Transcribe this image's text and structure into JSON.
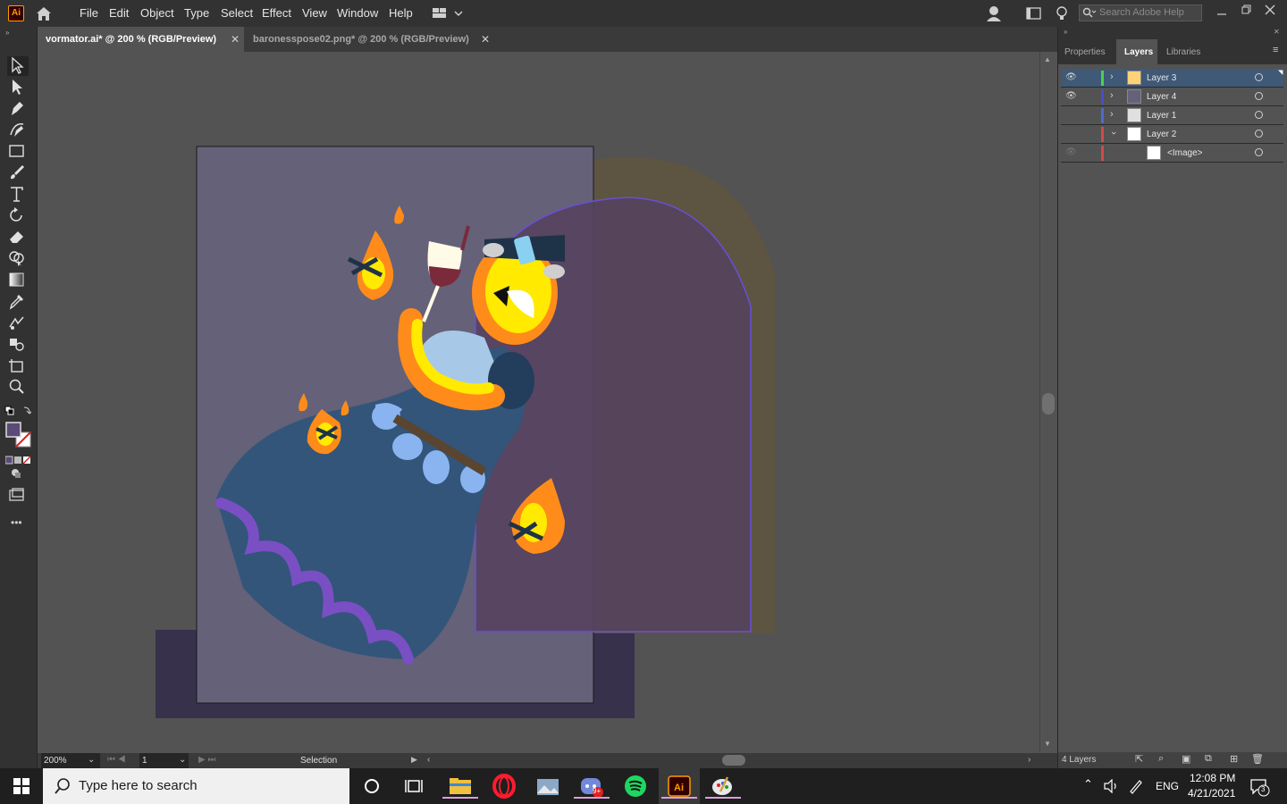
{
  "app": {
    "logo": "Ai",
    "name": "Adobe Illustrator"
  },
  "menu": {
    "items": [
      "File",
      "Edit",
      "Object",
      "Type",
      "Select",
      "Effect",
      "View",
      "Window",
      "Help"
    ],
    "search_placeholder": "Search Adobe Help"
  },
  "tabs": [
    {
      "label": "vormator.ai* @ 200 % (RGB/Preview)",
      "active": true
    },
    {
      "label": "baronesspose02.png* @ 200 % (RGB/Preview)",
      "active": false
    }
  ],
  "tools": [
    "selection-tool-icon",
    "direct-selection-tool-icon",
    "pen-tool-icon",
    "curvature-tool-icon",
    "rectangle-tool-icon",
    "paintbrush-tool-icon",
    "type-tool-icon",
    "rotate-tool-icon",
    "eraser-tool-icon",
    "shape-builder-tool-icon",
    "gradient-tool-icon",
    "eyedropper-tool-icon",
    "blend-tool-icon",
    "symbol-sprayer-tool-icon",
    "artboard-tool-icon",
    "zoom-tool-icon"
  ],
  "status": {
    "zoom": "200%",
    "artboard": "1",
    "tool": "Selection"
  },
  "panel": {
    "tabs": [
      "Properties",
      "Layers",
      "Libraries"
    ],
    "active_tab": "Layers",
    "layers": [
      {
        "name": "Layer 3",
        "color": "#4bd14b",
        "visible": true,
        "expanded": false,
        "selected": true
      },
      {
        "name": "Layer 4",
        "color": "#4b4bd1",
        "visible": true,
        "expanded": false,
        "selected": false
      },
      {
        "name": "Layer 1",
        "color": "#4b6bd1",
        "visible": false,
        "expanded": false,
        "selected": false
      },
      {
        "name": "Layer 2",
        "color": "#d14b4b",
        "visible": false,
        "expanded": true,
        "selected": false
      },
      {
        "name": "<Image>",
        "color": "#d14b4b",
        "visible": false,
        "expanded": false,
        "selected": false,
        "child": true
      }
    ],
    "layer_count": "4 Layers"
  },
  "taskbar": {
    "search_placeholder": "Type here to search",
    "language": "ENG",
    "time": "12:08 PM",
    "date": "4/21/2021",
    "notifications": "3",
    "discord_badge": "9+"
  },
  "colors": {
    "artboard": "#646179",
    "arch": "#5e5442",
    "arch_inner": "#55425e",
    "floor": "#37314b",
    "dress": "#33557a",
    "ruffle": "#7a4fc4",
    "flame_outer": "#ff8c1a",
    "flame_inner": "#ffea00",
    "accent_path": "#6a4fd6"
  }
}
